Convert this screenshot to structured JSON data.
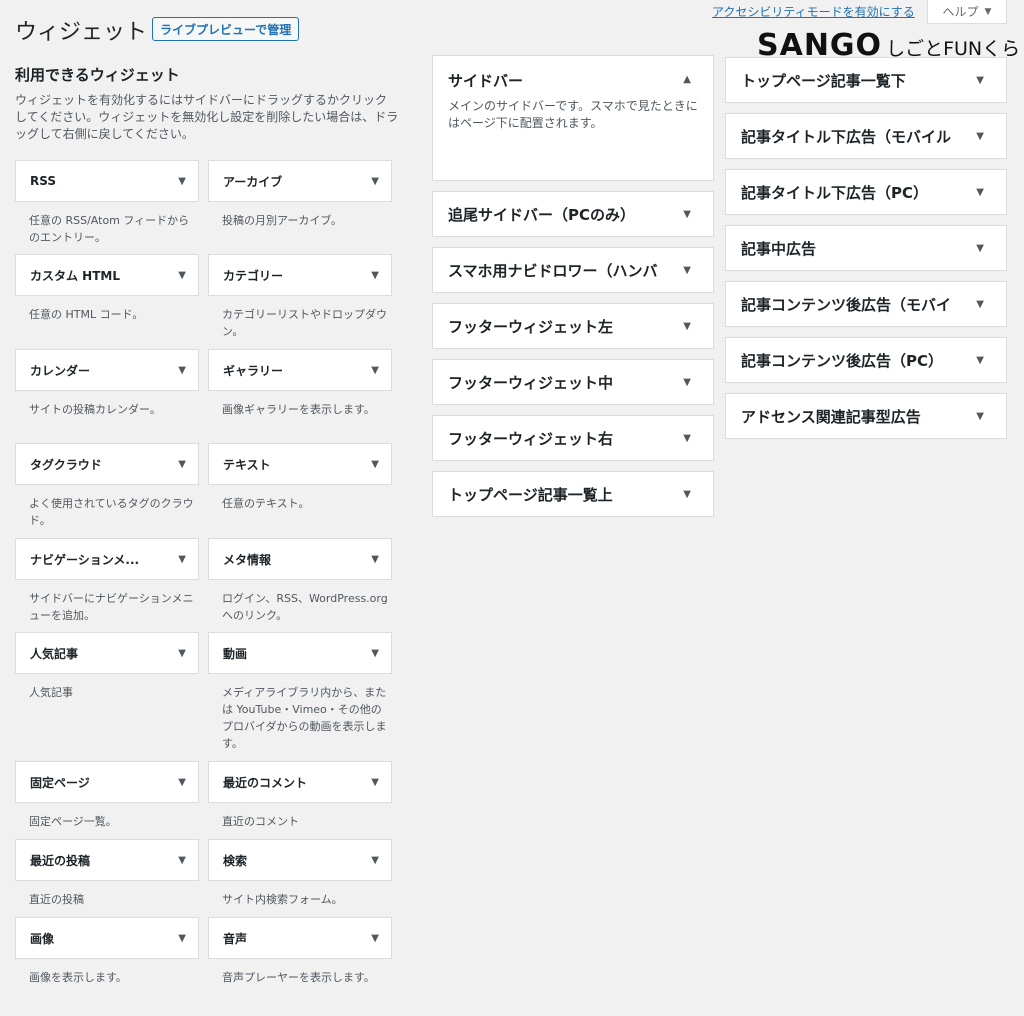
{
  "header": {
    "title": "ウィジェット",
    "live_preview": "ライブプレビューで管理",
    "accessibility_link": "アクセシビリティモードを有効にする",
    "help": "ヘルプ",
    "brand_main": "SANGO",
    "brand_sub": "しごとFUNくらぶ"
  },
  "available": {
    "title": "利用できるウィジェット",
    "description": "ウィジェットを有効化するにはサイドバーにドラッグするかクリックしてください。ウィジェットを無効化し設定を削除したい場合は、ドラッグして右側に戻してください。",
    "widgets": [
      {
        "name": "RSS",
        "desc": "任意の RSS/Atom フィードからのエントリー。"
      },
      {
        "name": "アーカイブ",
        "desc": "投稿の月別アーカイブ。"
      },
      {
        "name": "カスタム HTML",
        "desc": "任意の HTML コード。"
      },
      {
        "name": "カテゴリー",
        "desc": "カテゴリーリストやドロップダウン。"
      },
      {
        "name": "カレンダー",
        "desc": "サイトの投稿カレンダー。"
      },
      {
        "name": "ギャラリー",
        "desc": "画像ギャラリーを表示します。"
      },
      {
        "name": "タグクラウド",
        "desc": "よく使用されているタグのクラウド。"
      },
      {
        "name": "テキスト",
        "desc": "任意のテキスト。"
      },
      {
        "name": "ナビゲーションメ...",
        "desc": "サイドバーにナビゲーションメニューを追加。"
      },
      {
        "name": "メタ情報",
        "desc": "ログイン、RSS、WordPress.org へのリンク。"
      },
      {
        "name": "人気記事",
        "desc": "人気記事"
      },
      {
        "name": "動画",
        "desc": "メディアライブラリ内から、または YouTube・Vimeo・その他のプロバイダからの動画を表示します。"
      },
      {
        "name": "固定ページ",
        "desc": "固定ページ一覧。"
      },
      {
        "name": "最近のコメント",
        "desc": "直近のコメント"
      },
      {
        "name": "最近の投稿",
        "desc": "直近の投稿"
      },
      {
        "name": "検索",
        "desc": "サイト内検索フォーム。"
      },
      {
        "name": "画像",
        "desc": "画像を表示します。"
      },
      {
        "name": "音声",
        "desc": "音声プレーヤーを表示します。"
      }
    ]
  },
  "sidebar_open": {
    "title": "サイドバー",
    "description": "メインのサイドバーです。スマホで見たときにはページ下に配置されます。"
  },
  "sidebars_col1": [
    "追尾サイドバー（PCのみ）",
    "スマホ用ナビドロワー（ハンバ",
    "フッターウィジェット左",
    "フッターウィジェット中",
    "フッターウィジェット右",
    "トップページ記事一覧上"
  ],
  "sidebars_col2": [
    "トップページ記事一覧下",
    "記事タイトル下広告（モバイル",
    "記事タイトル下広告（PC）",
    "記事中広告",
    "記事コンテンツ後広告（モバイ",
    "記事コンテンツ後広告（PC）",
    "アドセンス関連記事型広告"
  ],
  "icons": {
    "arrow_down": "▼",
    "arrow_up": "▲"
  }
}
